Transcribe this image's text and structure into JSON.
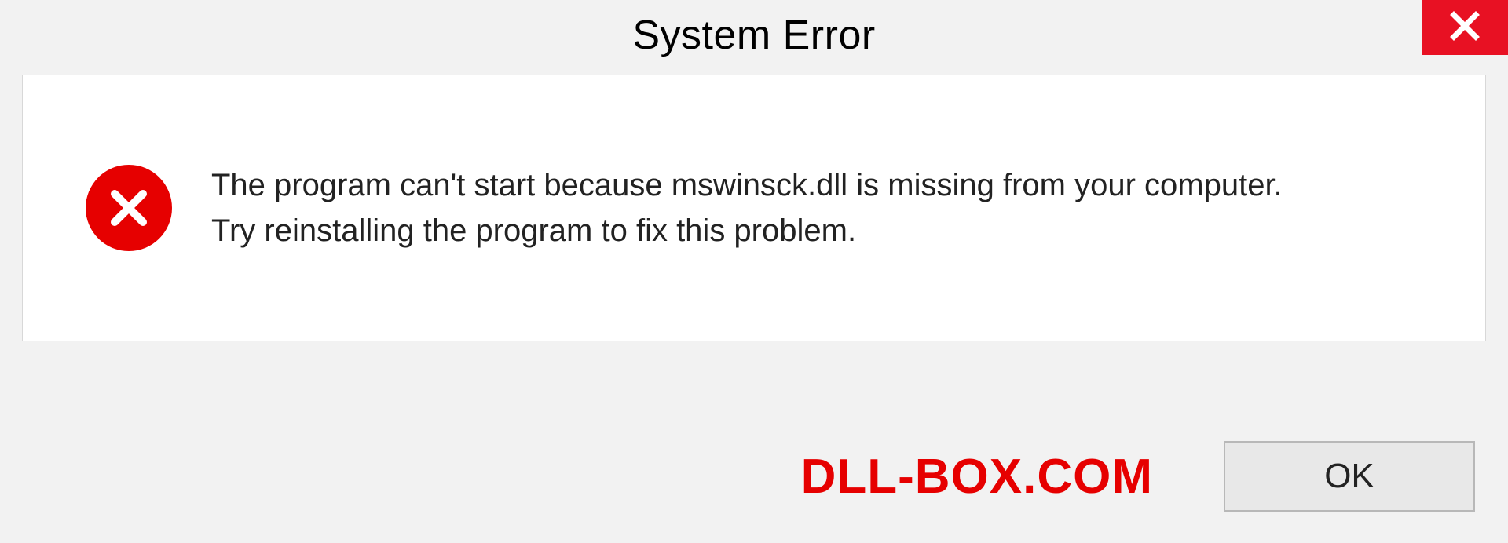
{
  "titlebar": {
    "title": "System Error"
  },
  "dialog": {
    "message_line1": "The program can't start because mswinsck.dll is missing from your computer.",
    "message_line2": "Try reinstalling the program to fix this problem."
  },
  "footer": {
    "watermark": "DLL-BOX.COM",
    "ok_label": "OK"
  },
  "colors": {
    "accent_red": "#e60000",
    "close_red": "#e81123"
  }
}
